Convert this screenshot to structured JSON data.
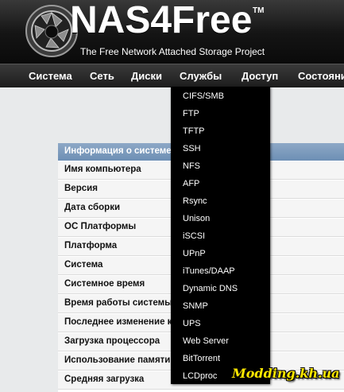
{
  "header": {
    "logo_text": "NAS4Free",
    "logo_tm": "TM",
    "tagline": "The Free Network Attached Storage Project"
  },
  "navbar": {
    "items": [
      {
        "label": "Система"
      },
      {
        "label": "Сеть"
      },
      {
        "label": "Диски"
      },
      {
        "label": "Службы"
      },
      {
        "label": "Доступ"
      },
      {
        "label": "Состояни"
      }
    ]
  },
  "dropdown": {
    "items": [
      {
        "label": "CIFS/SMB"
      },
      {
        "label": "FTP"
      },
      {
        "label": "TFTP"
      },
      {
        "label": "SSH"
      },
      {
        "label": "NFS"
      },
      {
        "label": "AFP"
      },
      {
        "label": "Rsync"
      },
      {
        "label": "Unison"
      },
      {
        "label": "iSCSI"
      },
      {
        "label": "UPnP"
      },
      {
        "label": "iTunes/DAAP"
      },
      {
        "label": "Dynamic DNS"
      },
      {
        "label": "SNMP"
      },
      {
        "label": "UPS"
      },
      {
        "label": "Web Server"
      },
      {
        "label": "BitTorrent"
      },
      {
        "label": "LCDproc"
      }
    ]
  },
  "system_info": {
    "title": "Информация о системе",
    "rows": [
      {
        "label": "Имя компьютера"
      },
      {
        "label": "Версия"
      },
      {
        "label": "Дата сборки"
      },
      {
        "label": "ОС Платформы"
      },
      {
        "label": "Платформа"
      },
      {
        "label": "Система"
      },
      {
        "label": "Системное время"
      },
      {
        "label": "Время работы системы"
      },
      {
        "label": "Последнее изменение к"
      },
      {
        "label": "Загрузка процессора"
      },
      {
        "label": "Использование памяти"
      },
      {
        "label": "Средняя загрузка"
      }
    ]
  },
  "watermark": "Modding.kh.ua",
  "colors": {
    "header_bg": "#141414",
    "panel_header": "#7896ba",
    "dropdown_bg": "#000000",
    "watermark": "#ffe800"
  }
}
